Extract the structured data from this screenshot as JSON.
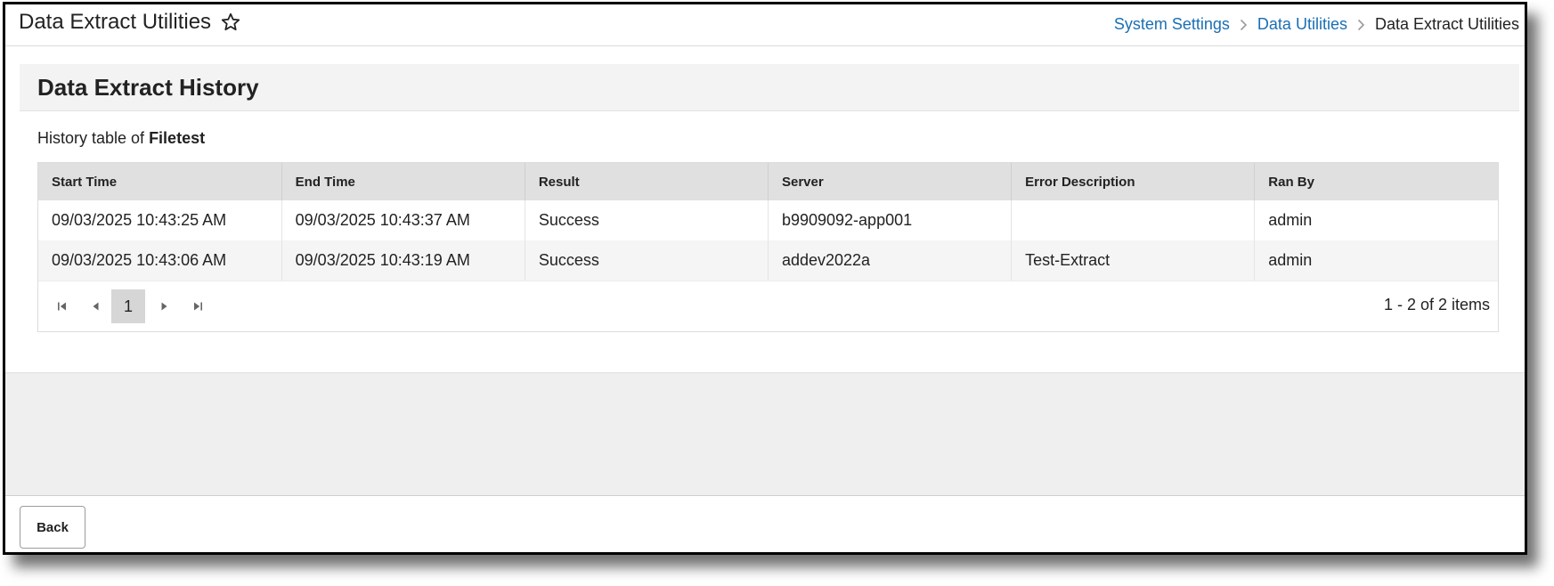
{
  "header": {
    "title": "Data Extract Utilities",
    "breadcrumb": [
      {
        "label": "System Settings"
      },
      {
        "label": "Data Utilities"
      },
      {
        "label": "Data Extract Utilities"
      }
    ]
  },
  "section": {
    "title": "Data Extract History",
    "subtitle_prefix": "History table of ",
    "subtitle_name": "Filetest"
  },
  "table": {
    "columns": [
      "Start Time",
      "End Time",
      "Result",
      "Server",
      "Error Description",
      "Ran By"
    ],
    "rows": [
      [
        "09/03/2025 10:43:25 AM",
        "09/03/2025 10:43:37 AM",
        "Success",
        "b9909092-app001",
        "",
        "admin"
      ],
      [
        "09/03/2025 10:43:06 AM",
        "09/03/2025 10:43:19 AM",
        "Success",
        "addev2022a",
        "Test-Extract",
        "admin"
      ]
    ]
  },
  "pager": {
    "current_page": "1",
    "info": "1 - 2 of 2 items"
  },
  "footer": {
    "back_label": "Back"
  },
  "icons": {
    "favorite": "star-outline-icon",
    "first": "page-first-icon",
    "prev": "page-prev-icon",
    "next": "page-next-icon",
    "last": "page-last-icon",
    "separator": "chevron-right-icon"
  },
  "colors": {
    "link": "#1a6fb4",
    "header_bg": "#e0e0e0",
    "section_bg": "#f3f3f3"
  }
}
